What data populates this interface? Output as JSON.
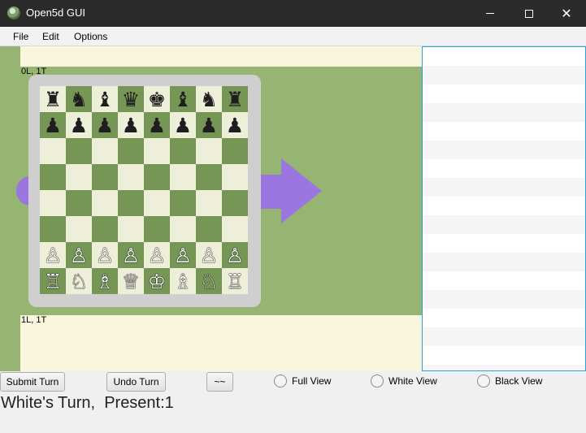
{
  "window": {
    "title": "Open5d GUI",
    "controls": {
      "minimize": "minimize",
      "maximize": "maximize",
      "close": "✕"
    }
  },
  "menu": [
    "File",
    "Edit",
    "Options"
  ],
  "timelines": [
    {
      "label": "0L, 1T"
    },
    {
      "label": "1L, 1T"
    }
  ],
  "board": {
    "rows": [
      [
        "♜",
        "♞",
        "♝",
        "♛",
        "♚",
        "♝",
        "♞",
        "♜"
      ],
      [
        "♟",
        "♟",
        "♟",
        "♟",
        "♟",
        "♟",
        "♟",
        "♟"
      ],
      [
        "",
        "",
        "",
        "",
        "",
        "",
        "",
        ""
      ],
      [
        "",
        "",
        "",
        "",
        "",
        "",
        "",
        ""
      ],
      [
        "",
        "",
        "",
        "",
        "",
        "",
        "",
        ""
      ],
      [
        "",
        "",
        "",
        "",
        "",
        "",
        "",
        ""
      ],
      [
        "♙",
        "♙",
        "♙",
        "♙",
        "♙",
        "♙",
        "♙",
        "♙"
      ],
      [
        "♖",
        "♘",
        "♗",
        "♕",
        "♔",
        "♗",
        "♘",
        "♖"
      ]
    ],
    "colors": {
      "light": "#eeefd8",
      "dark": "#769656",
      "frame": "#cfcfcf",
      "arrow": "#9b75e0",
      "band": "#96b572",
      "background": "#f8f7dd"
    }
  },
  "controls": {
    "submit_turn": "Submit Turn",
    "undo_turn": "Undo Turn",
    "tilde": "~~",
    "full_view": "Full View",
    "white_view": "White View",
    "black_view": "Black View"
  },
  "status": "White's Turn,  Present:1"
}
